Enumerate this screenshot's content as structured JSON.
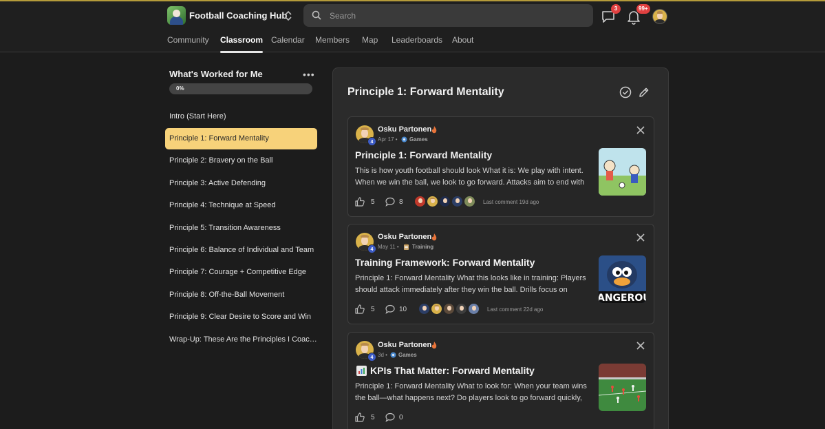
{
  "app": {
    "name": "Football Coaching Hub",
    "search_placeholder": "Search",
    "chat_badge": "3",
    "notif_badge": "99+"
  },
  "nav": {
    "tabs": [
      {
        "label": "Community"
      },
      {
        "label": "Classroom",
        "active": true
      },
      {
        "label": "Calendar"
      },
      {
        "label": "Members"
      },
      {
        "label": "Map"
      },
      {
        "label": "Leaderboards"
      },
      {
        "label": "About"
      }
    ]
  },
  "sidebar": {
    "title": "What's Worked for Me",
    "progress_label": "0%",
    "progress": 0,
    "lessons": [
      {
        "label": "Intro (Start Here)"
      },
      {
        "label": "Principle 1: Forward Mentality",
        "active": true
      },
      {
        "label": "Principle 2: Bravery on the Ball"
      },
      {
        "label": "Principle 3: Active Defending"
      },
      {
        "label": "Principle 4: Technique at Speed"
      },
      {
        "label": "Principle 5: Transition Awareness"
      },
      {
        "label": "Principle 6: Balance of Individual and Team"
      },
      {
        "label": "Principle 7: Courage + Competitive Edge"
      },
      {
        "label": "Principle 8: Off-the-Ball Movement"
      },
      {
        "label": "Principle 9: Clear Desire to Score and Win"
      },
      {
        "label": "Wrap-Up: These Are the Principles I Coach By"
      }
    ]
  },
  "main": {
    "title": "Principle 1: Forward Mentality",
    "posts": [
      {
        "author": "Osku Partonen",
        "level": "4",
        "date": "Apr 17",
        "category": "Games",
        "title": "Principle 1: Forward Mentality",
        "excerpt": "This is how youth football should look What it is: We play with intent. When we win the ball, we look to go forward. Attacks aim to end with a",
        "likes": "5",
        "comments": "8",
        "last_comment": "Last comment 19d ago",
        "thumb": "cartoon"
      },
      {
        "author": "Osku Partonen",
        "level": "4",
        "date": "May 11",
        "category": "Training",
        "title": "Training Framework: Forward Mentality",
        "excerpt": "Principle 1: Forward Mentality What this looks like in training: Players should attack immediately after they win the ball. Drills focus on",
        "likes": "5",
        "comments": "10",
        "last_comment": "Last comment 22d ago",
        "thumb": "dangerous",
        "thumb_text": "ANGEROUS"
      },
      {
        "author": "Osku Partonen",
        "level": "4",
        "date": "3d",
        "category": "Games",
        "title": "KPIs That Matter: Forward Mentality",
        "excerpt": "Principle 1: Forward Mentality What to look for: When your team wins the ball—what happens next? Do players look to go forward quickly, or",
        "likes": "5",
        "comments": "0",
        "last_comment": "",
        "thumb": "pitch"
      }
    ]
  },
  "colors": {
    "accent": "#f7d27a",
    "badge": "#e04040",
    "level": "#3c5bc5"
  }
}
